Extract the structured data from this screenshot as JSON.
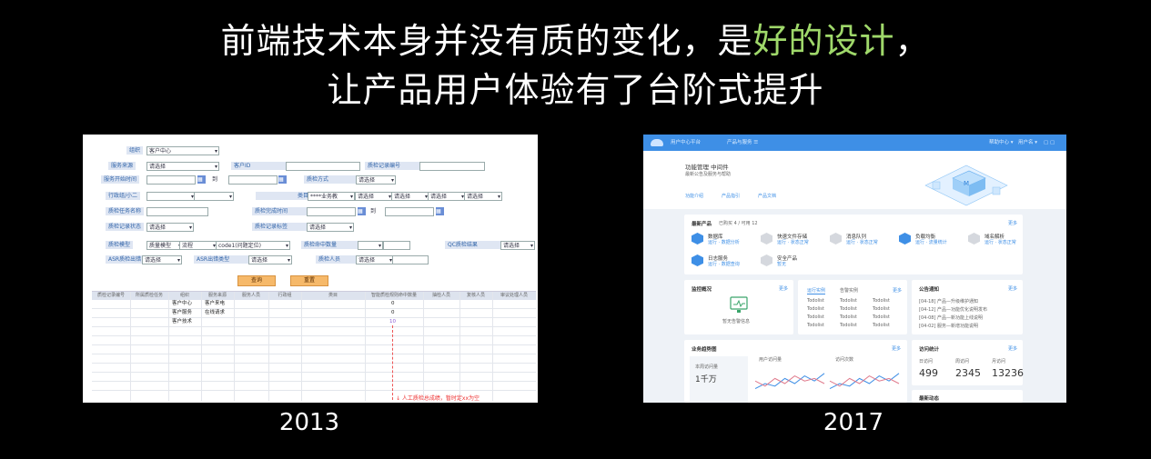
{
  "headline": {
    "line1_before": "前端技术本身并没有质的变化，是",
    "line1_highlight": "好的设计",
    "line1_after": "，",
    "line2": "让产品用户体验有了台阶式提升",
    "highlight_color": "#9fd86a"
  },
  "captions": {
    "left_year": "2013",
    "right_year": "2017"
  },
  "old_ui": {
    "labels": [
      "组织",
      "服务来源",
      "服务开始时间",
      "行政组/小二",
      "质检任务名称",
      "质检记录状态",
      "质检模型",
      "ASR质检出错",
      "客户ID",
      "质检方式",
      "质检完成时间",
      "质检记录标签",
      "类目",
      "质检命中数量",
      "ASR出错类型",
      "质检人员",
      "QC质检结果",
      "质检记录编号"
    ],
    "select_values": {
      "org": "客户中心",
      "placeholder": "请选择",
      "category": "****业务教",
      "model": "质量模型",
      "flow": "流程",
      "code": "code1(问题定位)"
    },
    "date_sep": "到",
    "buttons": {
      "query": "查询",
      "reset": "重置"
    },
    "table_headers": [
      "质检记录编号",
      "所属质检任务",
      "组织",
      "服务来源",
      "服务人员",
      "行政组",
      "类目",
      "智能质检规则命中数量",
      "抽检人员",
      "复核人员",
      "审议处理人员"
    ],
    "rows": [
      {
        "org": "客户中心",
        "source": "客户来电",
        "count": "0"
      },
      {
        "org": "客户服务",
        "source": "在线请求",
        "count": "0"
      },
      {
        "org": "客户技术",
        "source": "",
        "count": "10"
      }
    ],
    "red_note": "↓ 人工质检总成绩，暂时定xx为空"
  },
  "new_ui": {
    "topbar": {
      "brand": "用户中心平台",
      "nav": "产品与服务 ☰",
      "right1": "帮助中心 ▾",
      "right2": "用户名 ▾"
    },
    "header": {
      "title": "功能管理 中间件",
      "subtitle": "最新公告及服务与帮助",
      "actions": [
        "功能介绍",
        "产品指引",
        "产品文档"
      ]
    },
    "products": {
      "title": "最新产品",
      "meta": "已购买 4 / 可用 12",
      "more": "更多",
      "items": [
        {
          "name": "数据库",
          "desc": "运行 · 数据分析",
          "active": true
        },
        {
          "name": "快速文件存储",
          "desc": "运行 · 状态正常",
          "active": false
        },
        {
          "name": "消息队列",
          "desc": "运行 · 状态正常",
          "active": false
        },
        {
          "name": "负载均衡",
          "desc": "运行 · 流量统计",
          "active": true
        },
        {
          "name": "域名解析",
          "desc": "运行 · 状态正常",
          "active": false
        },
        {
          "name": "日志服务",
          "desc": "运行 · 数据查询",
          "active": true
        },
        {
          "name": "安全产品",
          "desc": "暂无",
          "active": false
        }
      ]
    },
    "monitor": {
      "title": "监控概况",
      "more": "更多",
      "caption": "暂无告警信息"
    },
    "tabs": {
      "tab1": "运行实例",
      "tab2": "告警实例",
      "more": "更多",
      "cell": "Todolist"
    },
    "notices": {
      "title": "公告通知",
      "more": "更多",
      "items": [
        "[04-18] 产品—升级维护通知",
        "[04-12] 产品—功能优化说明发布",
        "[04-08] 产品—新功能上线说明",
        "[04-02] 服务—新增功能说明"
      ]
    },
    "trend": {
      "title": "业务趋势图",
      "more": "更多",
      "summary_label": "本周访问量",
      "summary_value": "1千万",
      "legend1": "用户访问量",
      "legend2": "访问次数",
      "series1": [
        0.3,
        0.5,
        0.4,
        0.7,
        0.5,
        0.8,
        0.6,
        0.9
      ],
      "series2": [
        0.6,
        0.4,
        0.7,
        0.5,
        0.8,
        0.6,
        0.7,
        0.5
      ]
    },
    "stats": {
      "title": "访问统计",
      "more": "更多",
      "labels": [
        "日访问",
        "周访问",
        "月访问"
      ],
      "values": [
        "499",
        "2345",
        "13236"
      ]
    },
    "bottom_title": "最新动态"
  }
}
